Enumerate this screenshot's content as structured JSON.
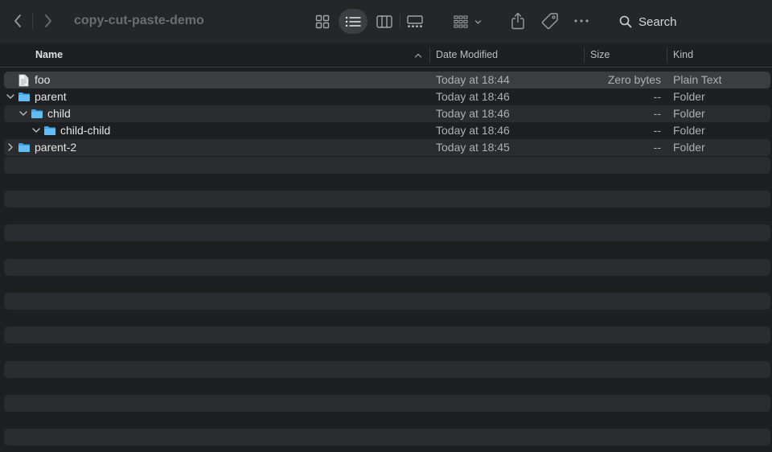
{
  "window": {
    "title": "copy-cut-paste-demo"
  },
  "toolbar": {
    "search_label": "Search",
    "active_view": "list"
  },
  "columns": {
    "name": "Name",
    "date_modified": "Date Modified",
    "size": "Size",
    "kind": "Kind",
    "sort_direction": "ascending"
  },
  "files": [
    {
      "name": "foo",
      "type": "file",
      "depth": 0,
      "disclosure": "none",
      "date": "Today at 18:44",
      "size": "Zero bytes",
      "kind": "Plain Text",
      "selected": true
    },
    {
      "name": "parent",
      "type": "folder",
      "depth": 0,
      "disclosure": "expanded",
      "date": "Today at 18:46",
      "size": "--",
      "kind": "Folder",
      "selected": false
    },
    {
      "name": "child",
      "type": "folder",
      "depth": 1,
      "disclosure": "expanded",
      "date": "Today at 18:46",
      "size": "--",
      "kind": "Folder",
      "selected": false
    },
    {
      "name": "child-child",
      "type": "folder",
      "depth": 2,
      "disclosure": "expanded",
      "date": "Today at 18:46",
      "size": "--",
      "kind": "Folder",
      "selected": false
    },
    {
      "name": "parent-2",
      "type": "folder",
      "depth": 0,
      "disclosure": "collapsed",
      "date": "Today at 18:45",
      "size": "--",
      "kind": "Folder",
      "selected": false
    }
  ],
  "colors": {
    "background": "#1e1f21",
    "toolbar": "#252628",
    "stripe": "#2b2c2f",
    "selected_row": "#3c3d40",
    "folder_blue": "#5ab7ee"
  }
}
